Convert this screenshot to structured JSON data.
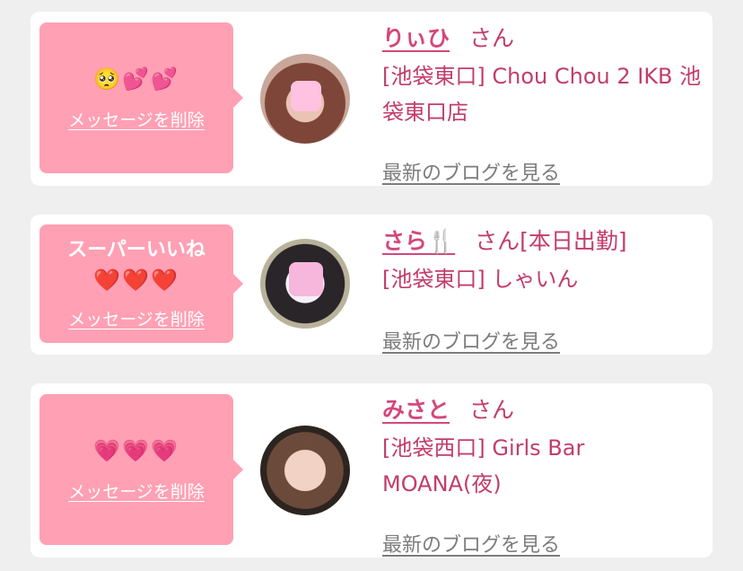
{
  "cards": [
    {
      "message_title": "",
      "message": "🥺💕💕",
      "delete_label": "メッセージを削除",
      "name": "りぃひ",
      "honorific": "さん",
      "shop": "[池袋東口] Chou Chou 2 IKB 池袋東口店",
      "blog_label": "最新のブログを見る"
    },
    {
      "message_title": "スーパーいいね",
      "message": "❤️❤️❤️",
      "delete_label": "メッセージを削除",
      "name": "さら🍴",
      "honorific": "さん[本日出勤]",
      "shop": "[池袋東口] しゃいん",
      "blog_label": "最新のブログを見る"
    },
    {
      "message_title": "",
      "message": "💗💗💗",
      "delete_label": "メッセージを削除",
      "name": "みさと",
      "honorific": "さん",
      "shop": "[池袋西口] Girls Bar MOANA(夜)",
      "blog_label": "最新のブログを見る"
    }
  ],
  "colors": {
    "bubble": "#ffa0b4",
    "name": "#d4477a",
    "text": "#c23d6a",
    "link_gray": "#7c7c7c",
    "background": "#efefef"
  }
}
